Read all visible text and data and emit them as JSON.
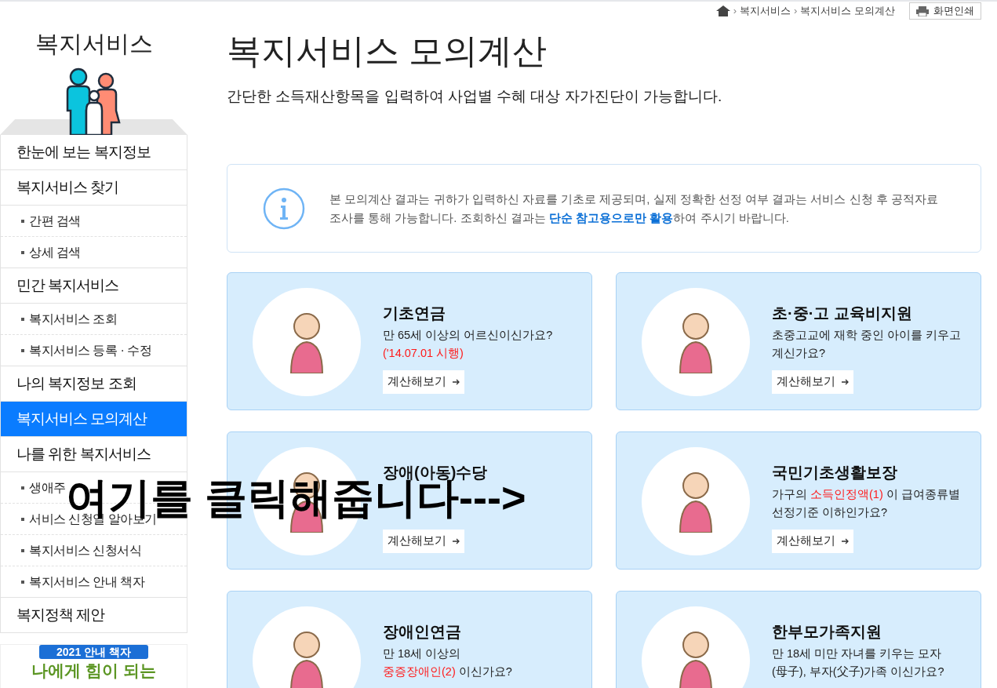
{
  "sidebar": {
    "title": "복지서비스",
    "items": [
      {
        "label": "한눈에 보는 복지정보",
        "kind": "main",
        "selected": false
      },
      {
        "label": "복지서비스 찾기",
        "kind": "main",
        "selected": false
      },
      {
        "label": "간편 검색",
        "kind": "sub",
        "selected": false
      },
      {
        "label": "상세 검색",
        "kind": "sub",
        "selected": false
      },
      {
        "label": "민간 복지서비스",
        "kind": "main",
        "selected": false
      },
      {
        "label": "복지서비스 조회",
        "kind": "sub",
        "selected": false
      },
      {
        "label": "복지서비스 등록 · 수정",
        "kind": "sub",
        "selected": false
      },
      {
        "label": "나의 복지정보 조회",
        "kind": "main",
        "selected": false
      },
      {
        "label": "복지서비스 모의계산",
        "kind": "main",
        "selected": true
      },
      {
        "label": "나를 위한 복지서비스",
        "kind": "main",
        "selected": false
      },
      {
        "label": "생애주",
        "kind": "sub",
        "selected": false
      },
      {
        "label": "서비스 신청일 알아보기",
        "kind": "sub",
        "selected": false
      },
      {
        "label": "복지서비스 신청서식",
        "kind": "sub",
        "selected": false
      },
      {
        "label": "복지서비스 안내 책자",
        "kind": "sub",
        "selected": false
      },
      {
        "label": "복지정책 제안",
        "kind": "main",
        "selected": false
      }
    ],
    "banner": {
      "badge": "2021 안내 책자",
      "title": "나에게 힘이 되는"
    }
  },
  "breadcrumb": [
    {
      "separator": "›",
      "label": "복지서비스"
    },
    {
      "separator": "›",
      "label": "복지서비스 모의계산"
    }
  ],
  "print_button": "화면인쇄",
  "page": {
    "title": "복지서비스 모의계산",
    "subtitle": "간단한 소득재산항목을 입력하여 사업별 수혜 대상 자가진단이 가능합니다."
  },
  "notice": [
    {
      "text": "본 모의계산 결과는 귀하가 입력하신 자료를 기초로 제공되며, 실제 정확한 선정 여부 결과는 서비스 신청 후 공적자료 조사를 통해 가능합니다. 조회하신 결과는 ",
      "highlight": false
    },
    {
      "text": "단순 참고용으로만 활용",
      "highlight": true
    },
    {
      "text": "하여 주시기 바랍니다.",
      "highlight": false
    }
  ],
  "cards": [
    {
      "title": "기초연금",
      "lines": [
        [
          {
            "text": "만 65세 이상의 어르신이신가요?",
            "highlight": false
          }
        ],
        [
          {
            "text": "('14.07.01 시행)",
            "highlight": true
          }
        ]
      ],
      "button": "계산해보기"
    },
    {
      "title": "초·중·고 교육비지원",
      "lines": [
        [
          {
            "text": "초중고교에 재학 중인 아이를 키우고",
            "highlight": false
          }
        ],
        [
          {
            "text": "계신가요?",
            "highlight": false
          }
        ]
      ],
      "button": "계산해보기"
    },
    {
      "title": "장애(아동)수당",
      "button": "계산해보기"
    },
    {
      "title": "국민기초생활보장",
      "lines": [
        [
          {
            "text": "가구의 ",
            "highlight": false
          },
          {
            "text": "소득인정액(1)",
            "highlight": true
          },
          {
            "text": " 이 급여종류별",
            "highlight": false
          }
        ],
        [
          {
            "text": "선정기준 이하인가요?",
            "highlight": false
          }
        ]
      ],
      "button": "계산해보기"
    },
    {
      "title": "장애인연금",
      "lines": [
        [
          {
            "text": "만 18세 이상의",
            "highlight": false
          }
        ],
        [
          {
            "text": "중증장애인(2)",
            "highlight": true
          },
          {
            "text": " 이신가요?",
            "highlight": false
          }
        ]
      ]
    },
    {
      "title": "한부모가족지원",
      "lines": [
        [
          {
            "text": "만 18세 미만 자녀를 키우는 모자",
            "highlight": false
          }
        ],
        [
          {
            "text": "(母子), 부자(父子)가족 이신가요?",
            "highlight": false
          }
        ]
      ]
    }
  ],
  "annotation": "여기를 클릭해줍니다--->"
}
